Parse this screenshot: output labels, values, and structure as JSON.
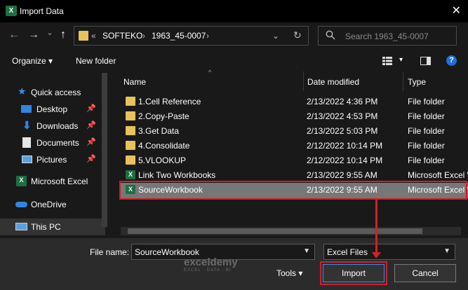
{
  "window": {
    "title": "Import Data",
    "close": "✕",
    "app_icon": "X"
  },
  "nav": {
    "back": "←",
    "forward": "→",
    "recent": "⌄",
    "up": "↑",
    "address": {
      "prefix": "«",
      "crumb1": "SOFTEKO",
      "sep": "›",
      "crumb2": "1963_45-0007",
      "sep2": "›",
      "dropdown": "⌄",
      "refresh": "↻"
    },
    "search_placeholder": "Search 1963_45-0007"
  },
  "toolbar": {
    "organize": "Organize ▾",
    "new_folder": "New folder",
    "help": "?",
    "view_menu": "▾"
  },
  "sidebar": {
    "items": [
      {
        "label": "Quick access",
        "icon": "star-icon"
      },
      {
        "label": "Desktop",
        "icon": "desktop-icon",
        "pinned": true
      },
      {
        "label": "Downloads",
        "icon": "download-icon",
        "pinned": true
      },
      {
        "label": "Documents",
        "icon": "documents-icon",
        "pinned": true
      },
      {
        "label": "Pictures",
        "icon": "pictures-icon",
        "pinned": true
      },
      {
        "label": "Microsoft Excel",
        "icon": "excel-icon"
      },
      {
        "label": "OneDrive",
        "icon": "cloud-icon"
      },
      {
        "label": "This PC",
        "icon": "computer-icon"
      }
    ],
    "pin": "📌"
  },
  "columns": {
    "name": "Name",
    "date": "Date modified",
    "type": "Type"
  },
  "files": [
    {
      "name": "1.Cell Reference",
      "date": "2/13/2022 4:36 PM",
      "type": "File folder",
      "kind": "folder"
    },
    {
      "name": "2.Copy-Paste",
      "date": "2/13/2022 4:53 PM",
      "type": "File folder",
      "kind": "folder"
    },
    {
      "name": "3.Get Data",
      "date": "2/13/2022 5:03 PM",
      "type": "File folder",
      "kind": "folder"
    },
    {
      "name": "4.Consolidate",
      "date": "2/12/2022 10:14 PM",
      "type": "File folder",
      "kind": "folder"
    },
    {
      "name": "5.VLOOKUP",
      "date": "2/12/2022 10:14 PM",
      "type": "File folder",
      "kind": "folder"
    },
    {
      "name": "Link Two Workbooks",
      "date": "2/13/2022 9:55 AM",
      "type": "Microsoft Excel W",
      "kind": "excel"
    },
    {
      "name": "SourceWorkbook",
      "date": "2/13/2022 9:55 AM",
      "type": "Microsoft Excel W",
      "kind": "excel",
      "selected": true
    }
  ],
  "bottom": {
    "file_name_label": "File name:",
    "file_name_value": "SourceWorkbook",
    "filter_value": "Excel Files",
    "tools": "Tools ▾",
    "import": "Import",
    "cancel": "Cancel"
  },
  "watermark": {
    "main": "exceldemy",
    "sub": "EXCEL · DATA · BI"
  },
  "colors": {
    "highlight": "#d0202a",
    "selection": "#777777",
    "folder": "#e8c25a",
    "excel": "#1d6f42"
  }
}
